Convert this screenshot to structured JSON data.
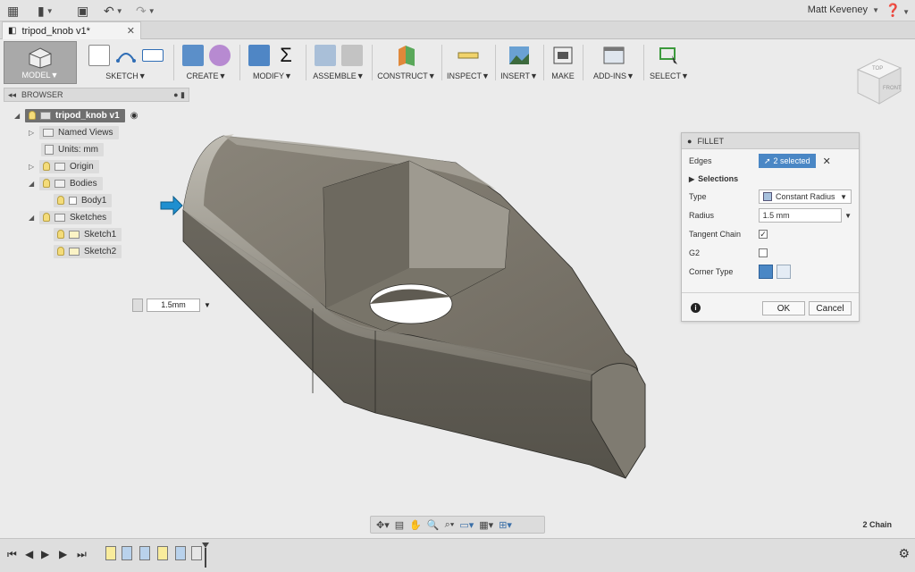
{
  "topbar": {
    "user": "Matt Keveney",
    "icons": [
      "grid-icon",
      "file-icon",
      "save-icon",
      "undo-icon",
      "redo-icon",
      "help-icon"
    ]
  },
  "tab": {
    "title": "tripod_knob v1*"
  },
  "toolbar": {
    "model": "MODEL",
    "groups": [
      "SKETCH",
      "CREATE",
      "MODIFY",
      "ASSEMBLE",
      "CONSTRUCT",
      "INSPECT",
      "INSERT",
      "MAKE",
      "ADD-INS",
      "SELECT"
    ]
  },
  "browser": {
    "title": "BROWSER",
    "root": "tripod_knob v1",
    "items": [
      "Named Views",
      "Units: mm",
      "Origin",
      "Bodies",
      "Body1",
      "Sketches",
      "Sketch1",
      "Sketch2"
    ]
  },
  "fillet": {
    "title": "FILLET",
    "edges_label": "Edges",
    "edges_value": "2 selected",
    "selections": "Selections",
    "type_label": "Type",
    "type_value": "Constant Radius",
    "radius_label": "Radius",
    "radius_value": "1.5 mm",
    "tangent_label": "Tangent Chain",
    "tangent_checked": true,
    "g2_label": "G2",
    "g2_checked": false,
    "corner_label": "Corner Type",
    "ok": "OK",
    "cancel": "Cancel"
  },
  "dimension": {
    "value": "1.5mm"
  },
  "status": {
    "text": "2 Chain"
  },
  "viewcube": {
    "top": "TOP",
    "front": "FRONT"
  },
  "colors": {
    "accent": "#4a87c5",
    "body": "#6e6a60",
    "arrow": "#1e8fd0"
  }
}
